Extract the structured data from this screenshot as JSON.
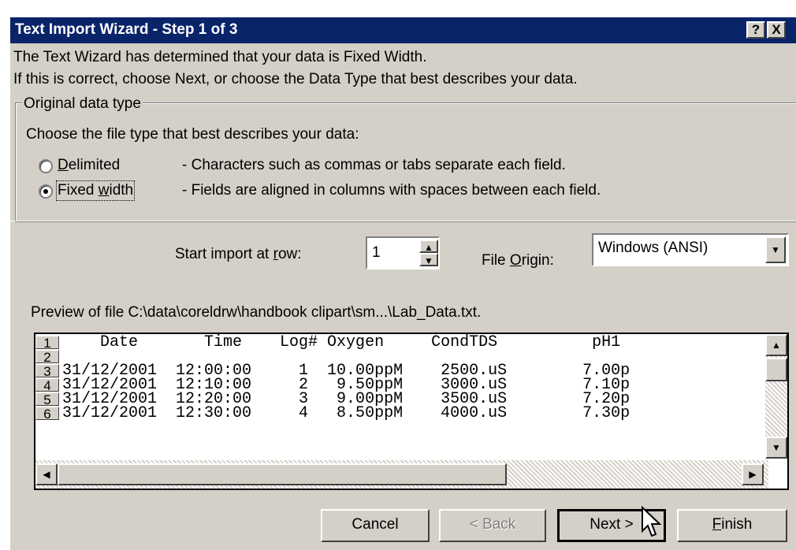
{
  "window": {
    "title": "Text Import Wizard - Step 1 of 3",
    "help_label": "?",
    "close_label": "X"
  },
  "intro": {
    "line1": "The Text Wizard has determined that your data is Fixed Width.",
    "line2": "If this is correct, choose Next, or choose the Data Type that best describes your data."
  },
  "data_type": {
    "group_label": "Original data type",
    "prompt": "Choose the file type that best describes your data:",
    "options": [
      {
        "label": "Delimited",
        "mnemonic": "D",
        "desc": "- Characters such as commas or tabs separate each field.",
        "selected": false
      },
      {
        "label": "Fixed width",
        "mnemonic": "w",
        "desc": "- Fields are aligned in columns with spaces between each field.",
        "selected": true
      }
    ]
  },
  "start_row": {
    "label": "Start import at row:",
    "value": "1"
  },
  "file_origin": {
    "label": "File Origin:",
    "value": "Windows (ANSI)"
  },
  "preview": {
    "label": "Preview of file C:\\data\\coreldrw\\handbook clipart\\sm...\\Lab_Data.txt.",
    "rows": [
      {
        "num": "1",
        "text": "    Date       Time    Log# Oxygen     CondTDS          pH1"
      },
      {
        "num": "2",
        "text": ""
      },
      {
        "num": "3",
        "text": "31/12/2001  12:00:00     1  10.00ppM    2500.uS        7.00p"
      },
      {
        "num": "4",
        "text": "31/12/2001  12:10:00     2   9.50ppM    3000.uS        7.10p"
      },
      {
        "num": "5",
        "text": "31/12/2001  12:20:00     3   9.00ppM    3500.uS        7.20p"
      },
      {
        "num": "6",
        "text": "31/12/2001  12:30:00     4   8.50ppM    4000.uS        7.30p"
      }
    ]
  },
  "buttons": {
    "cancel": "Cancel",
    "back": "< Back",
    "next": "Next >",
    "finish": "Finish"
  },
  "colors": {
    "titlebar": "#0a246a",
    "face": "#d4d0c8"
  }
}
